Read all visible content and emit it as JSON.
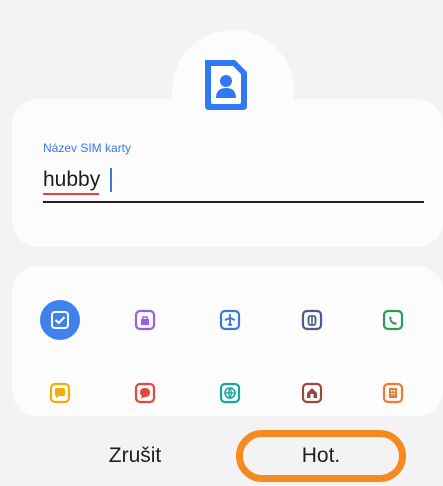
{
  "dialog": {
    "field_label": "Název SIM karty",
    "field_value": "hubby",
    "cancel_label": "Zrušit",
    "done_label": "Hot."
  },
  "icons": [
    {
      "name": "checkbox-icon",
      "color": "#ffffff",
      "selected": true
    },
    {
      "name": "bag-icon",
      "color": "#9a5ee6"
    },
    {
      "name": "airplane-icon",
      "color": "#3e79d8"
    },
    {
      "name": "luggage-icon",
      "color": "#4a5d86"
    },
    {
      "name": "phone-icon",
      "color": "#2e9c52"
    },
    {
      "name": "chat-icon",
      "color": "#f0b000"
    },
    {
      "name": "speech-bubble-icon",
      "color": "#e4473e"
    },
    {
      "name": "globe-icon",
      "color": "#19a6a0"
    },
    {
      "name": "home-icon",
      "color": "#9a4a42"
    },
    {
      "name": "building-icon",
      "color": "#f07a38"
    }
  ],
  "colors": {
    "accent": "#3b78e7",
    "highlight": "#f58a1f"
  }
}
